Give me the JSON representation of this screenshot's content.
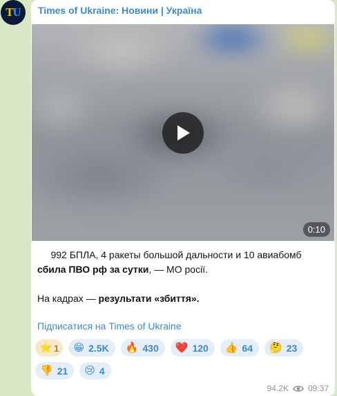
{
  "channel": {
    "avatar_letter_1": "T",
    "avatar_letter_2": "U",
    "name": "Times of Ukraine: Новини | Україна"
  },
  "video": {
    "duration": "0:10"
  },
  "post": {
    "line1": "992 БПЛА, 4 ракеты большой дальности и 10 авиабомб",
    "line2_bold": "сбила ПВО рф за сутки",
    "line2_rest": ", — МО росії.",
    "line3_prefix": "На кадрах — ",
    "line3_bold": "результати «збиття».",
    "subscribe_link": "Підписатися на Times of Ukraine"
  },
  "reactions": [
    {
      "emoji": "⭐",
      "count": "1",
      "selected": true
    },
    {
      "emoji": "😁",
      "count": "2.5K"
    },
    {
      "emoji": "🔥",
      "count": "430"
    },
    {
      "emoji": "❤️",
      "count": "120"
    },
    {
      "emoji": "👍",
      "count": "64"
    },
    {
      "emoji": "🤔",
      "count": "23"
    },
    {
      "emoji": "👎",
      "count": "21"
    },
    {
      "emoji": "😢",
      "count": "4"
    }
  ],
  "meta": {
    "views": "94.2K",
    "time": "09:37"
  },
  "colors": {
    "accent": "#3a8ac9",
    "chat_background": "#d8e8c4",
    "reaction_background": "#e3eef8"
  }
}
